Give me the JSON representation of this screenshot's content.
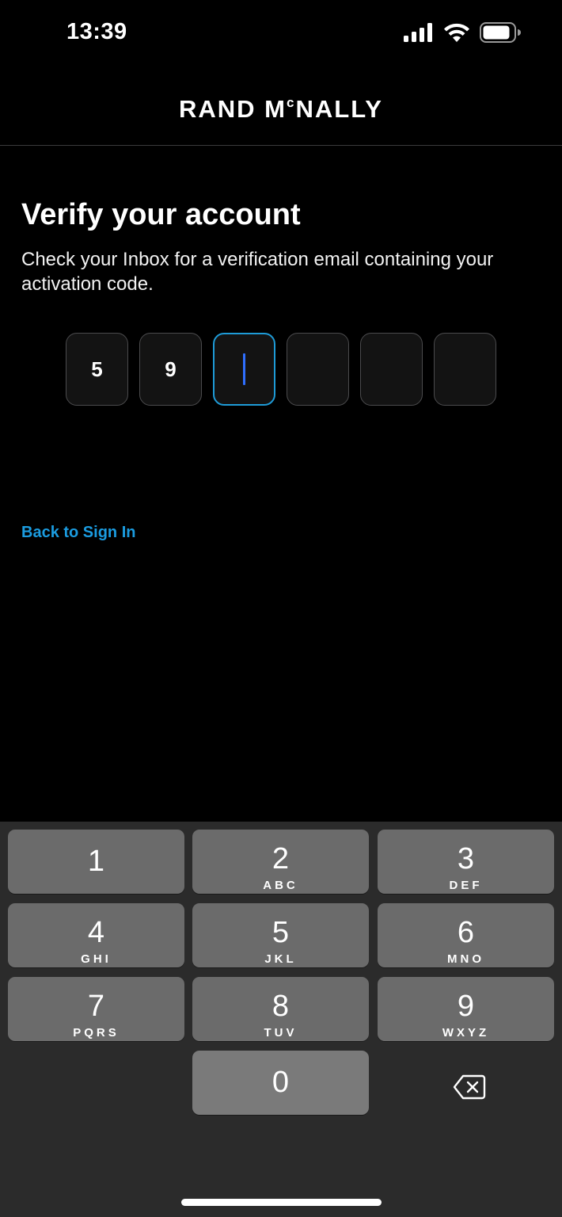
{
  "status": {
    "time": "13:39"
  },
  "brand": {
    "main": "RAND M",
    "sup": "c",
    "tail": "NALLY"
  },
  "page": {
    "title": "Verify your account",
    "description": "Check your Inbox for a verification email containing your activation code."
  },
  "code": {
    "digits": [
      "5",
      "9",
      "",
      "",
      "",
      ""
    ]
  },
  "links": {
    "back": "Back to Sign In"
  },
  "keyboard": {
    "keys": [
      {
        "num": "1",
        "letters": ""
      },
      {
        "num": "2",
        "letters": "ABC"
      },
      {
        "num": "3",
        "letters": "DEF"
      },
      {
        "num": "4",
        "letters": "GHI"
      },
      {
        "num": "5",
        "letters": "JKL"
      },
      {
        "num": "6",
        "letters": "MNO"
      },
      {
        "num": "7",
        "letters": "PQRS"
      },
      {
        "num": "8",
        "letters": "TUV"
      },
      {
        "num": "9",
        "letters": "WXYZ"
      },
      {
        "num": "0",
        "letters": ""
      }
    ]
  },
  "icons": {
    "signal": "cellular-signal-icon",
    "wifi": "wifi-icon",
    "battery": "battery-icon",
    "delete": "backspace-icon"
  },
  "colors": {
    "accent": "#1b9ce0",
    "active_border": "#1e9bd7",
    "caret": "#2f6fff"
  }
}
